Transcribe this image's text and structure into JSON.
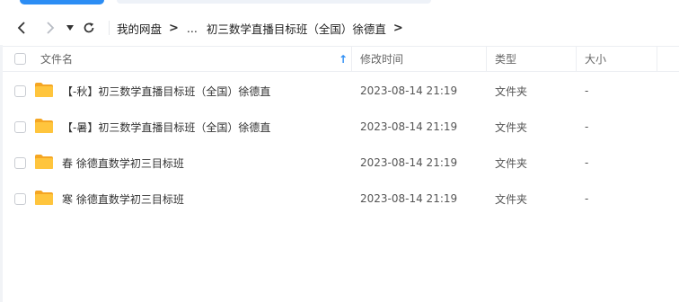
{
  "toolbar": {
    "icons": [
      "back-icon",
      "forward-icon",
      "history-dropdown-icon",
      "refresh-icon"
    ],
    "breadcrumb": {
      "root": "我的网盘",
      "ellipsis": "...",
      "current": "初三数学直播目标班（全国）徐德直"
    }
  },
  "list": {
    "columns": {
      "name": "文件名",
      "modified": "修改时间",
      "type": "类型",
      "size": "大小"
    },
    "sort_indicator": "↑",
    "rows": [
      {
        "name": "【-秋】初三数学直播目标班（全国）徐德直",
        "modified": "2023-08-14 21:19",
        "type": "文件夹",
        "size": "-"
      },
      {
        "name": "【-暑】初三数学直播目标班（全国）徐德直",
        "modified": "2023-08-14 21:19",
        "type": "文件夹",
        "size": "-"
      },
      {
        "name": "春 徐德直数学初三目标班",
        "modified": "2023-08-14 21:19",
        "type": "文件夹",
        "size": "-"
      },
      {
        "name": "寒 徐德直数学初三目标班",
        "modified": "2023-08-14 21:19",
        "type": "文件夹",
        "size": "-"
      }
    ]
  },
  "colors": {
    "accent": "#2c8df4",
    "folder": "#ffc53d",
    "folder_dark": "#f5a623",
    "divider": "#eceef2"
  }
}
